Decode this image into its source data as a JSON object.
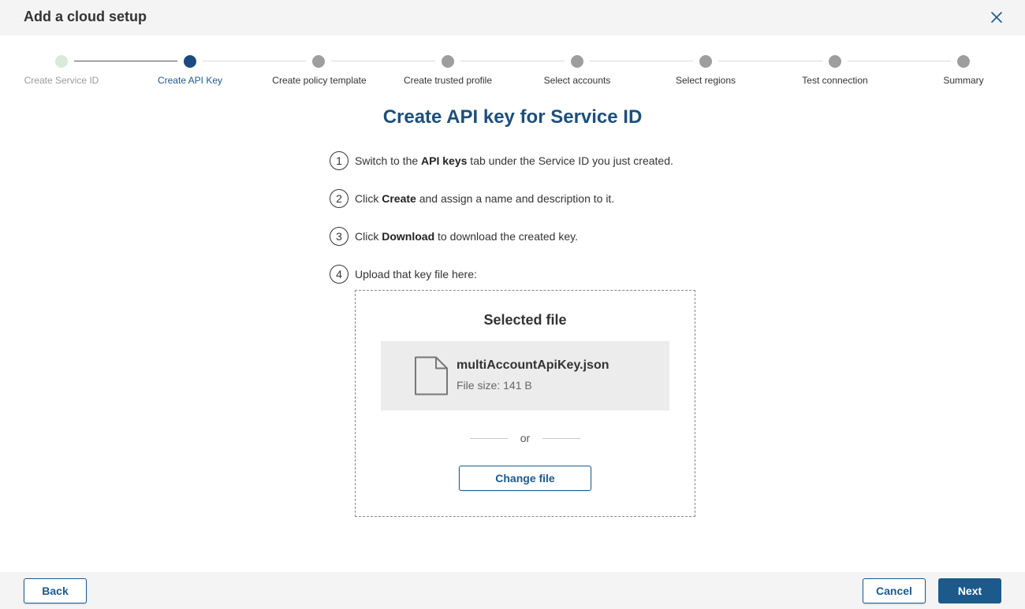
{
  "header": {
    "title": "Add a cloud setup"
  },
  "stepper": {
    "steps": [
      {
        "label": "Create Service ID",
        "state": "done"
      },
      {
        "label": "Create API Key",
        "state": "active"
      },
      {
        "label": "Create policy template",
        "state": "pending"
      },
      {
        "label": "Create trusted profile",
        "state": "pending"
      },
      {
        "label": "Select accounts",
        "state": "pending"
      },
      {
        "label": "Select regions",
        "state": "pending"
      },
      {
        "label": "Test connection",
        "state": "pending"
      },
      {
        "label": "Summary",
        "state": "pending"
      }
    ]
  },
  "main": {
    "title": "Create API key for Service ID",
    "instructions": [
      {
        "num": "1",
        "pre": "Switch to the ",
        "bold": "API keys",
        "post": " tab under the Service ID you just created."
      },
      {
        "num": "2",
        "pre": "Click ",
        "bold": "Create",
        "post": " and assign a name and description to it."
      },
      {
        "num": "3",
        "pre": "Click ",
        "bold": "Download",
        "post": " to download the created key."
      },
      {
        "num": "4",
        "pre": "Upload that key file here:",
        "bold": "",
        "post": ""
      }
    ]
  },
  "upload": {
    "title": "Selected file",
    "file_name": "multiAccountApiKey.json",
    "file_size": "File size: 141 B",
    "or_text": "or",
    "change_label": "Change file"
  },
  "footer": {
    "back_label": "Back",
    "cancel_label": "Cancel",
    "next_label": "Next"
  },
  "colors": {
    "accent": "#1c5a8c",
    "active_step": "#1c4a7e",
    "done_step": "#d8ead8",
    "pending_step": "#9e9e9e"
  }
}
